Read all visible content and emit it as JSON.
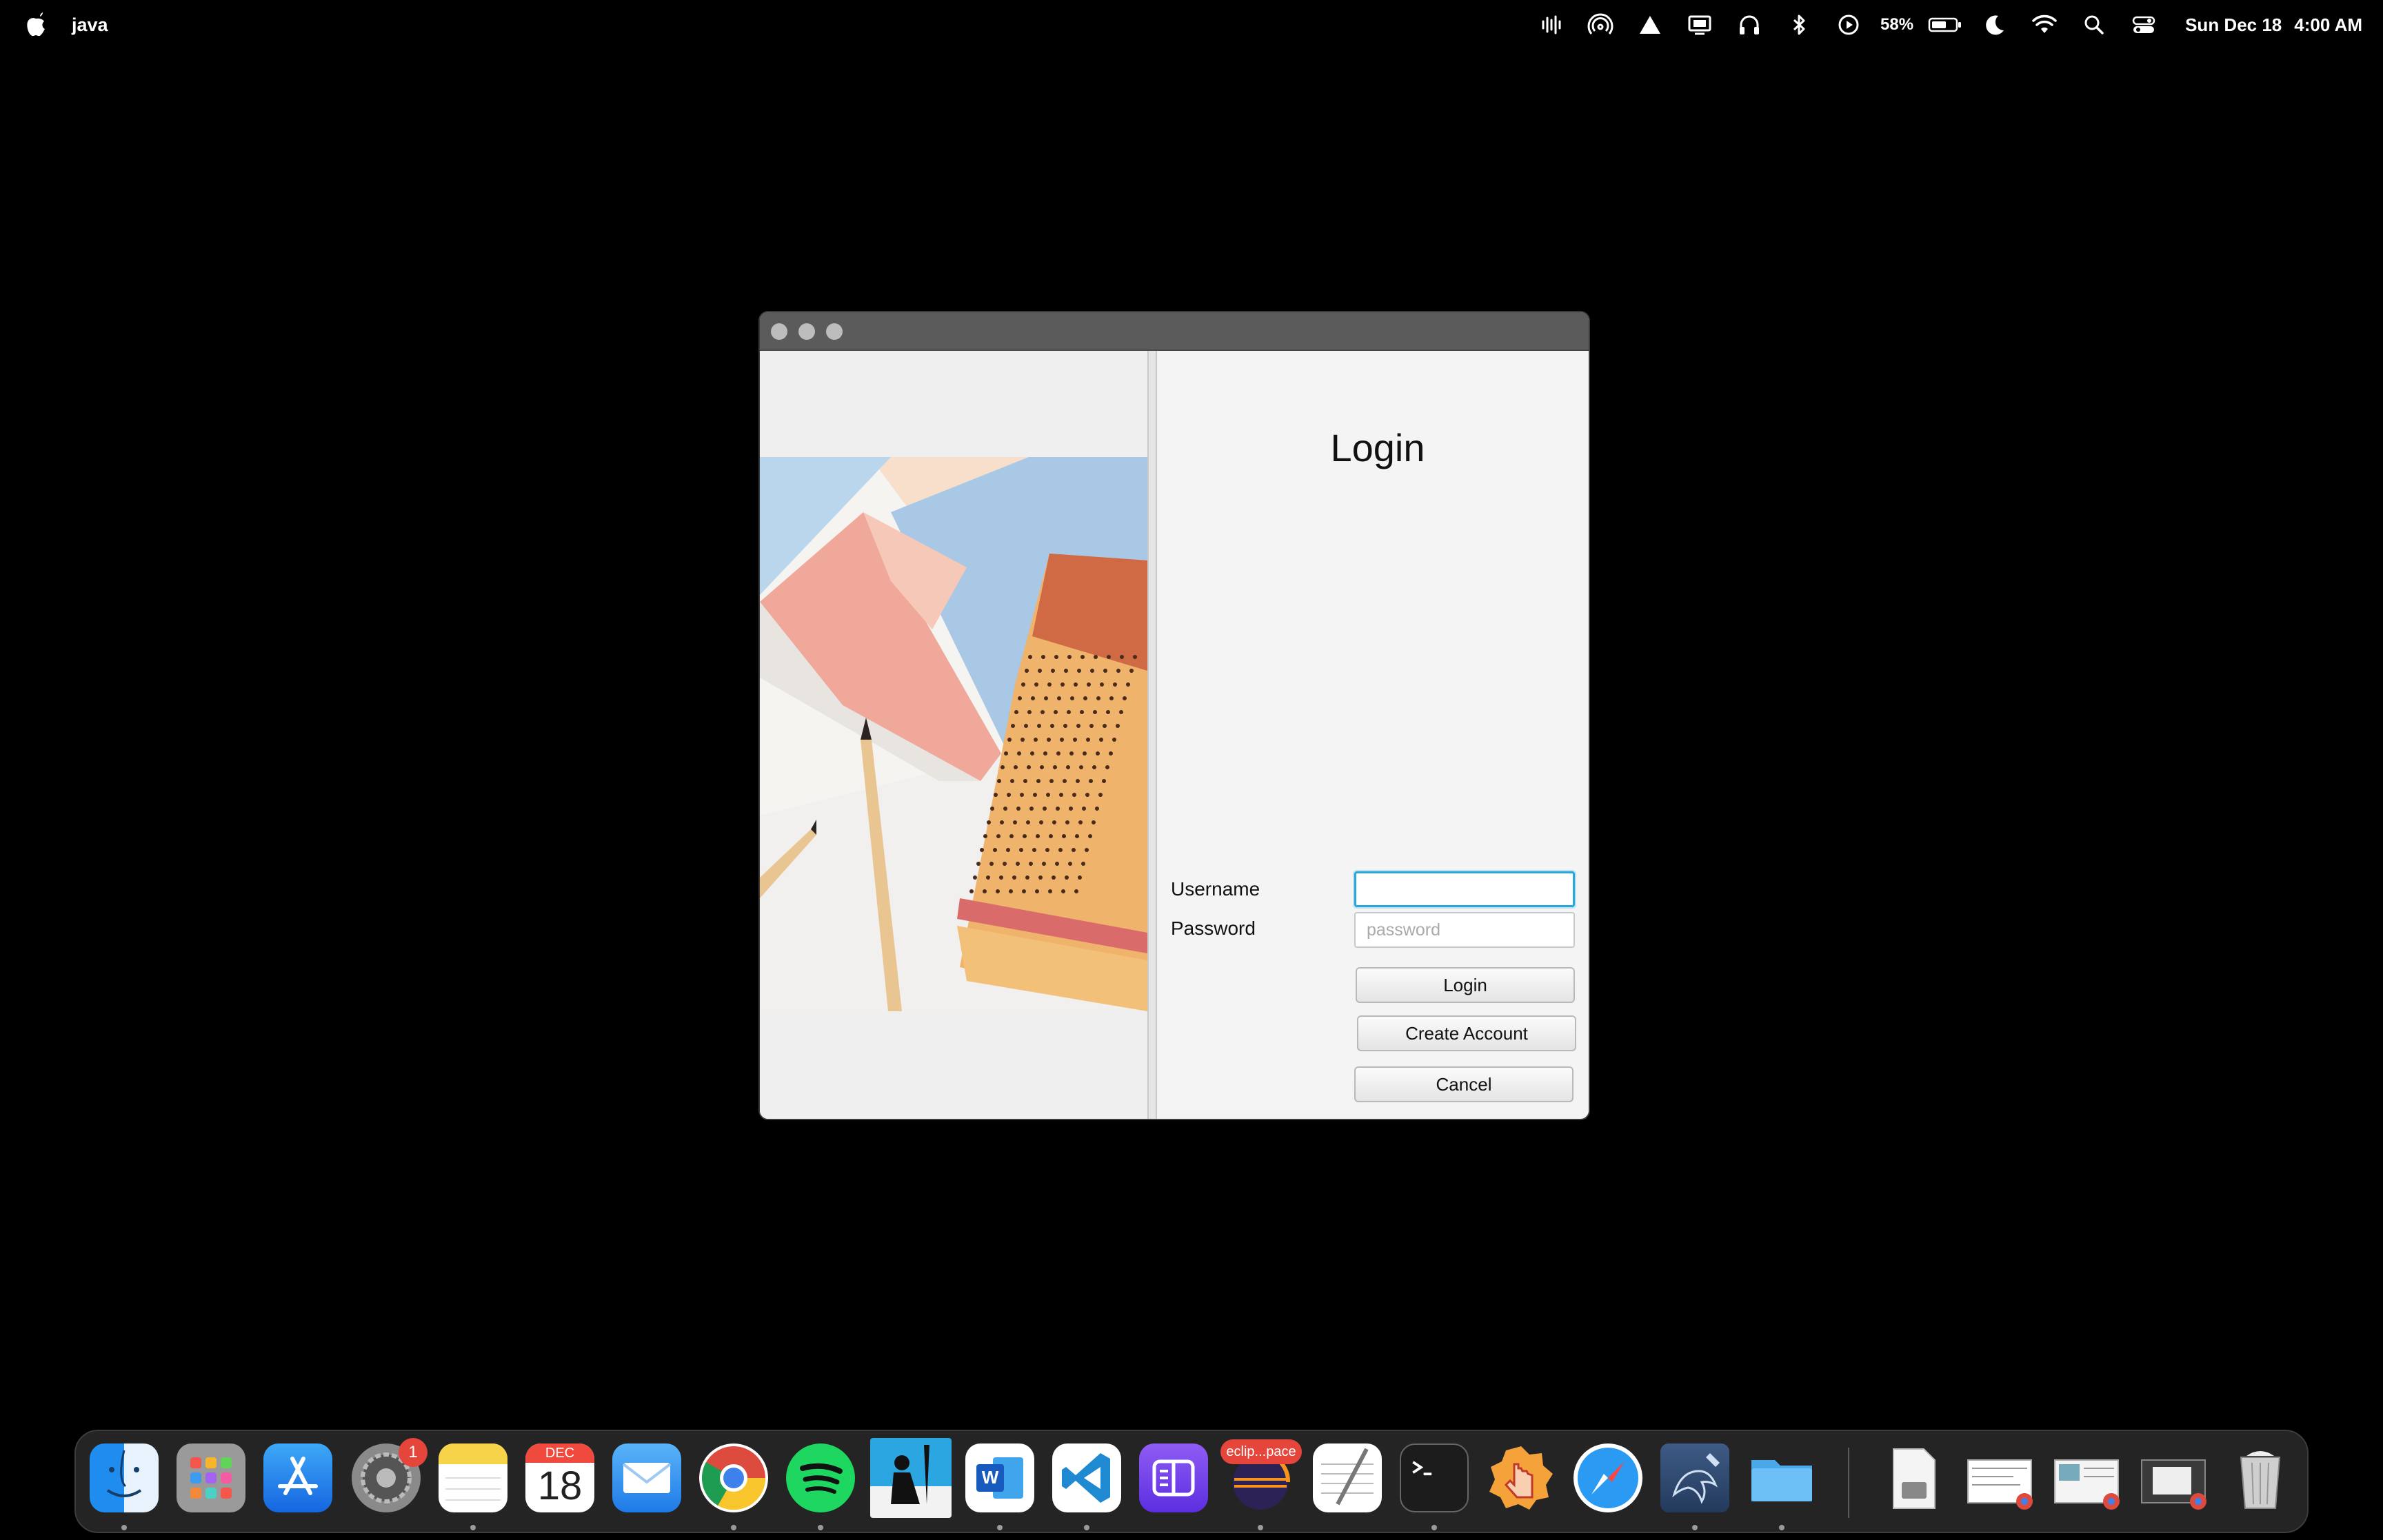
{
  "menubar": {
    "app_name": "java",
    "battery_percent": "58%",
    "date": "Sun Dec 18",
    "time": "4:00 AM"
  },
  "window": {
    "title": "Login",
    "username_label": "Username",
    "username_value": "",
    "password_label": "Password",
    "password_placeholder": "password",
    "login_button": "Login",
    "create_account_button": "Create Account",
    "cancel_button": "Cancel"
  },
  "dock": {
    "settings_badge": "1",
    "calendar_month": "DEC",
    "calendar_day": "18",
    "eclipse_label": "eclip...pace",
    "items": [
      "Finder",
      "Launchpad",
      "App Store",
      "System Settings",
      "Notes",
      "Calendar",
      "Mail",
      "Chrome",
      "Spotify",
      "Kindle",
      "Word",
      "VS Code",
      "Mirror",
      "Eclipse",
      "TextEdit",
      "Terminal",
      "Hand",
      "Safari",
      "MySQL Workbench",
      "Folder"
    ]
  },
  "colors": {
    "focus_ring": "#2aa6d8",
    "window_bg": "#f3f3f3",
    "titlebar": "#5b5b5b"
  }
}
